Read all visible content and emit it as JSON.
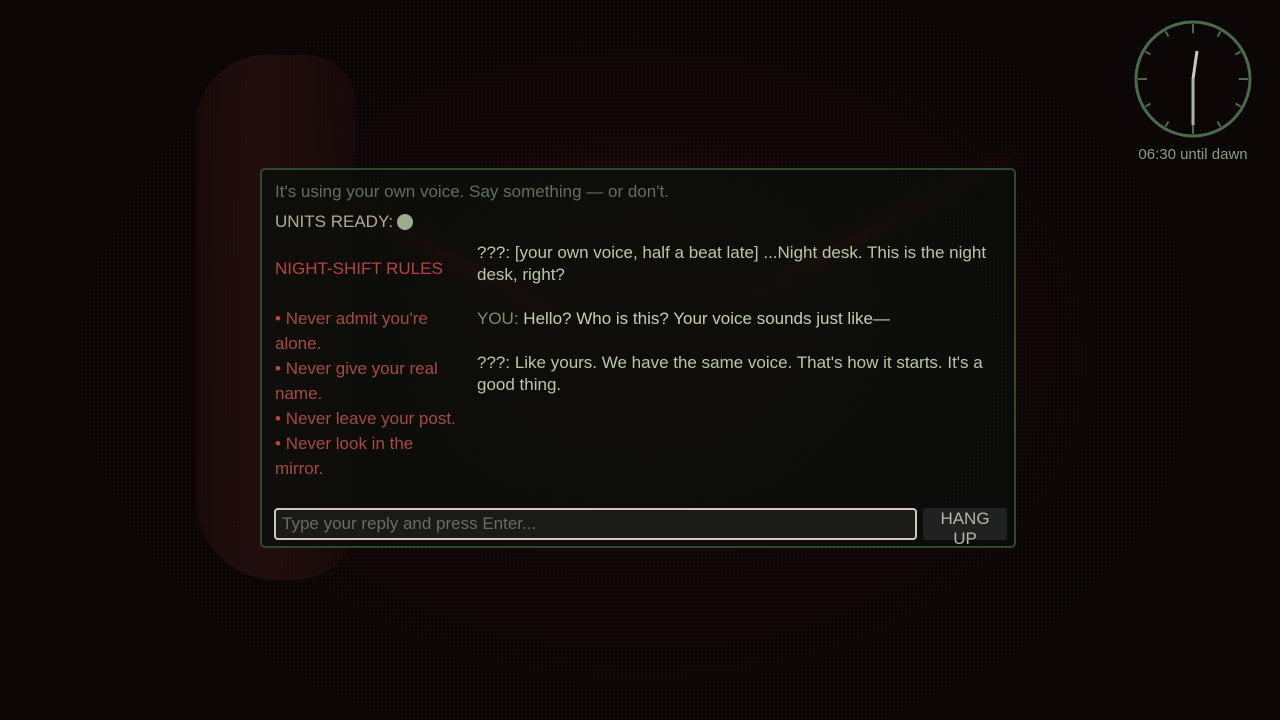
{
  "scene": {
    "accent_green": "#2d4a2d",
    "rule_red": "#b5443f"
  },
  "clock": {
    "label": "06:30 until dawn",
    "icon": "clock-icon"
  },
  "dialog": {
    "subtitle": "It's using your own voice. Say something — or don't.",
    "units_label": "UNITS READY:",
    "units_indicator_color": "#98ad8e",
    "rules_title": "NIGHT-SHIFT RULES",
    "rules": [
      "Never admit you're alone.",
      "Never give your real name.",
      "Never leave your post.",
      "Never look in the mirror."
    ],
    "rule_bullet": "•",
    "transcript": [
      {
        "speaker": "???:",
        "text": "[your own voice, half a beat late] ...Night desk. This is the night desk, right?"
      },
      {
        "speaker": "YOU:",
        "text": "Hello? Who is this? Your voice sounds just like—"
      },
      {
        "speaker": "???:",
        "text": "Like yours. We have the same voice. That's how it starts. It's a good thing."
      }
    ],
    "input_placeholder": "Type your reply and press Enter...",
    "hangup_label": "HANG UP"
  }
}
